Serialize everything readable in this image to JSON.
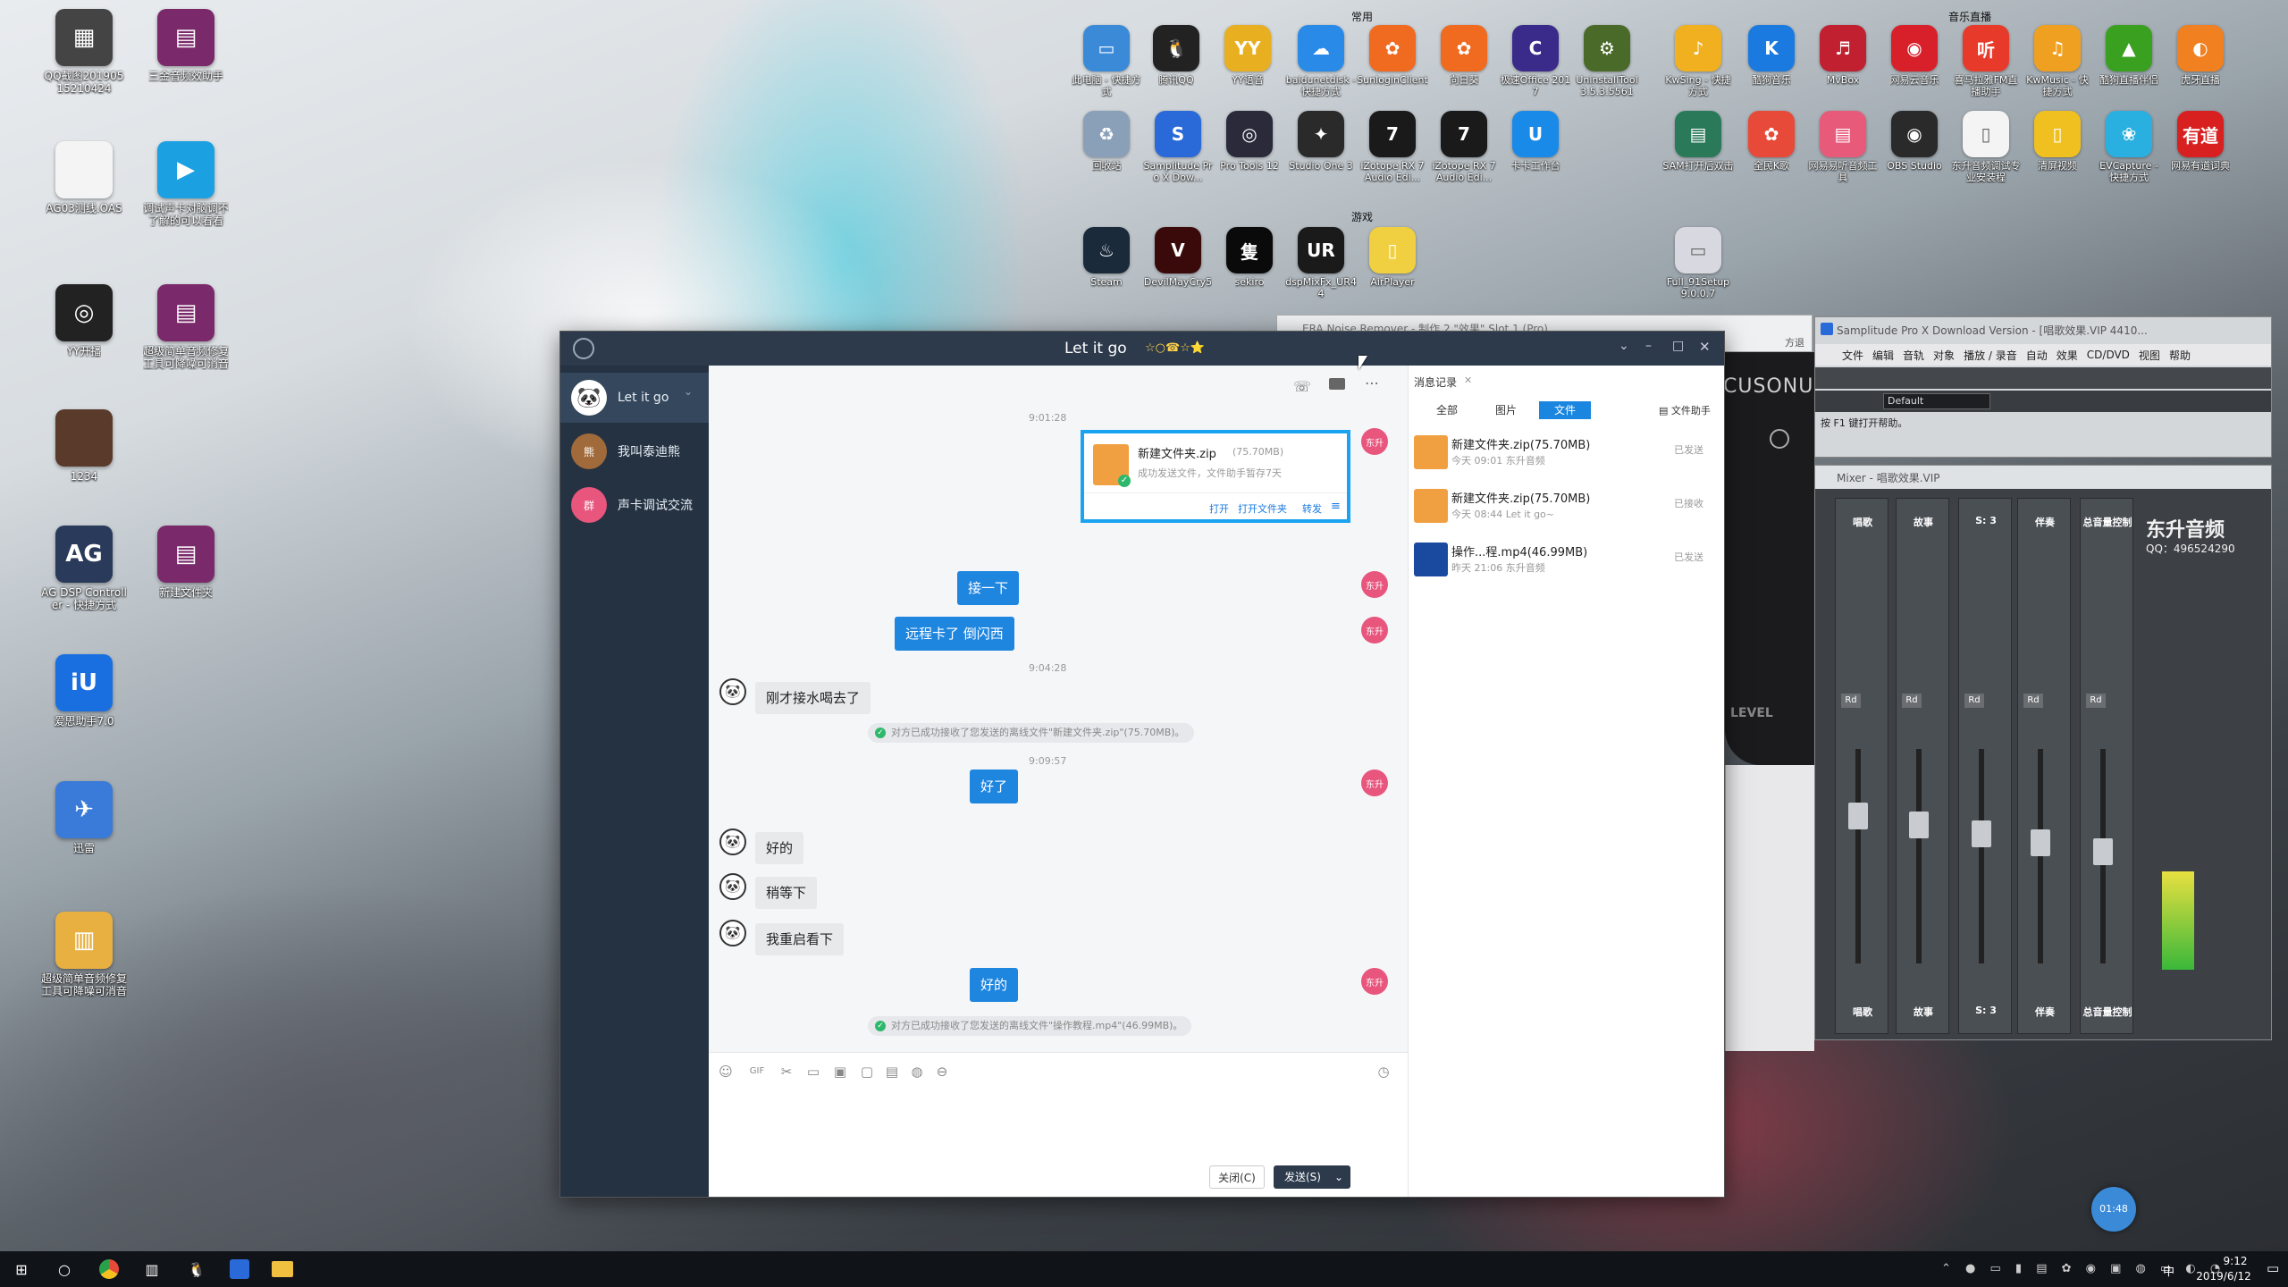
{
  "desktop": {
    "left_icons": [
      {
        "label": "QQ截图20190515210424",
        "color": "#444",
        "glyph": "▦"
      },
      {
        "label": "三金音频效助手",
        "color": "#7a2a6a",
        "glyph": "▤"
      },
      {
        "label": "AG03测线.OAS",
        "color": "#f4f4f4",
        "glyph": ""
      },
      {
        "label": "调试声卡对脑调不了解的可以看看",
        "color": "#1ba0e2",
        "glyph": "▶"
      },
      {
        "label": "YY开播",
        "color": "#222",
        "glyph": "◎"
      },
      {
        "label": "超级简单音频修复工具可降噪可消音",
        "color": "#7a2a6a",
        "glyph": "▤"
      },
      {
        "label": "1234",
        "color": "#5a3a2a",
        "glyph": ""
      },
      {
        "label": "AG DSP Controller - 快捷方式",
        "color": "#2a3a5a",
        "glyph": "AG"
      },
      {
        "label": "新建文件夹",
        "color": "#7a2a6a",
        "glyph": "▤"
      },
      {
        "label": "爱思助手7.0",
        "color": "#1a6fe0",
        "glyph": "iU"
      },
      {
        "label": "迅雷",
        "color": "#3a7ad8",
        "glyph": "✈"
      },
      {
        "label": "超级简单音频修复工具可降噪可消音",
        "color": "#e8b040",
        "glyph": "▥"
      }
    ],
    "top_headers": {
      "common": "常用",
      "music_live": "音乐直播",
      "games": "游戏"
    },
    "top_icons_row1": [
      {
        "label": "此电脑 - 快捷方式",
        "color": "#3a8ad8",
        "glyph": "▭"
      },
      {
        "label": "腾讯QQ",
        "color": "#222",
        "glyph": "🐧"
      },
      {
        "label": "YY语音",
        "color": "#e8b020",
        "glyph": "YY"
      },
      {
        "label": "baidunetdisk - 快捷方式",
        "color": "#2a8ae8",
        "glyph": "☁"
      },
      {
        "label": "SunloginClient",
        "color": "#f06a20",
        "glyph": "✿"
      },
      {
        "label": "向日葵",
        "color": "#f06a20",
        "glyph": "✿"
      },
      {
        "label": "极速Office 2017",
        "color": "#3a2a8a",
        "glyph": "C"
      },
      {
        "label": "UninstallTool 3.5.3.5561",
        "color": "#4a6a2a",
        "glyph": "⚙"
      },
      {
        "label": "KwSing - 快捷方式",
        "color": "#f0b020",
        "glyph": "♪"
      },
      {
        "label": "酷狗音乐",
        "color": "#1a7ae0",
        "glyph": "K"
      },
      {
        "label": "MvBox",
        "color": "#c02030",
        "glyph": "♬"
      },
      {
        "label": "网易云音乐",
        "color": "#d8202a",
        "glyph": "◉"
      },
      {
        "label": "喜马拉雅FM直播助手",
        "color": "#e83a2a",
        "glyph": "听"
      },
      {
        "label": "KwMusic - 快捷方式",
        "color": "#f0a020",
        "glyph": "♫"
      },
      {
        "label": "酷狗直播伴侣",
        "color": "#3aa020",
        "glyph": "▲"
      },
      {
        "label": "虎牙直播",
        "color": "#f08020",
        "glyph": "◐"
      }
    ],
    "top_icons_row2": [
      {
        "label": "回收站",
        "color": "#8aa0b8",
        "glyph": "♻"
      },
      {
        "label": "Samplitude Pro X Dow...",
        "color": "#2a6ad8",
        "glyph": "S"
      },
      {
        "label": "Pro Tools 12",
        "color": "#2a2a3a",
        "glyph": "◎"
      },
      {
        "label": "Studio One 3",
        "color": "#2a2a2a",
        "glyph": "✦"
      },
      {
        "label": "iZotope RX 7 Audio Edi...",
        "color": "#1a1a1a",
        "glyph": "7"
      },
      {
        "label": "iZotope RX 7 Audio Edi...",
        "color": "#1a1a1a",
        "glyph": "7"
      },
      {
        "label": "卡卡工作台",
        "color": "#1a8ae8",
        "glyph": "U"
      },
      {
        "label": "SAM打开后双击",
        "color": "#2a7a5a",
        "glyph": "▤"
      },
      {
        "label": "全民K歌",
        "color": "#e84a3a",
        "glyph": "✿"
      },
      {
        "label": "网易易听音频工具",
        "color": "#e85a7a",
        "glyph": "▤"
      },
      {
        "label": "OBS Studio",
        "color": "#2a2a2a",
        "glyph": "◉"
      },
      {
        "label": "东升音频调试专业安装程",
        "color": "#f4f4f4",
        "glyph": "▯"
      },
      {
        "label": "清屏视频",
        "color": "#f0c020",
        "glyph": "▯"
      },
      {
        "label": "EVCapture - 快捷方式",
        "color": "#2ab0e0",
        "glyph": "❀"
      },
      {
        "label": "网易有道词典",
        "color": "#d82020",
        "glyph": "有道"
      }
    ],
    "top_icons_row3": [
      {
        "label": "Steam",
        "color": "#1a2a3a",
        "glyph": "♨"
      },
      {
        "label": "DevilMayCry5",
        "color": "#3a0a0a",
        "glyph": "V"
      },
      {
        "label": "sekiro",
        "color": "#0a0a0a",
        "glyph": "隻"
      },
      {
        "label": "dspMixFx_UR44",
        "color": "#1a1a1a",
        "glyph": "UR"
      },
      {
        "label": "AirPlayer",
        "color": "#f0d040",
        "glyph": "▯"
      },
      {
        "label": "Full_91Setup 9.0.0.7",
        "color": "#d8d8e0",
        "glyph": "▭"
      }
    ]
  },
  "chat": {
    "title": "Let it go",
    "title_stars": "☆○☎☆⭐",
    "contacts": [
      {
        "name": "Let it go",
        "active": true,
        "avatar": "🐼",
        "avatar_color": "#fff"
      },
      {
        "name": "我叫泰迪熊",
        "active": false,
        "avatar": "熊",
        "avatar_color": "#a06a3a"
      },
      {
        "name": "声卡调试交流",
        "active": false,
        "avatar": "群",
        "avatar_color": "#e8557d"
      }
    ],
    "timestamps": [
      "9:01:28",
      "9:04:28",
      "9:09:57"
    ],
    "file_card": {
      "name": "新建文件夹.zip",
      "size": "(75.70MB)",
      "status": "成功发送文件，文件助手暂存7天",
      "actions": [
        "打开",
        "打开文件夹",
        "转发"
      ]
    },
    "outgoing": [
      "接一下",
      "远程卡了 倒闪西",
      "好了",
      "好的"
    ],
    "incoming": [
      "刚才接水喝去了",
      "好的",
      "稍等下",
      "我重启看下"
    ],
    "system_messages": [
      "对方已成功接收了您发送的离线文件\"新建文件夹.zip\"(75.70MB)。",
      "对方已成功接收了您发送的离线文件\"操作教程.mp4\"(46.99MB)。"
    ],
    "my_avatar_text": "东升",
    "buttons": {
      "close": "关闭(C)",
      "send": "发送(S)"
    },
    "right_panel": {
      "title": "消息记录",
      "tabs": [
        "全部",
        "图片",
        "文件"
      ],
      "active_tab": "文件",
      "assistant": "文件助手",
      "records": [
        {
          "name": "新建文件夹.zip(75.70MB)",
          "time": "今天 09:01 东升音频",
          "status": "已发送",
          "color": "#f0a040"
        },
        {
          "name": "新建文件夹.zip(75.70MB)",
          "time": "今天 08:44 Let it go~",
          "status": "已接收",
          "color": "#f0a040"
        },
        {
          "name": "操作...程.mp4(46.99MB)",
          "time": "昨天 21:06 东升音频",
          "status": "已发送",
          "color": "#1a4aa0"
        }
      ]
    }
  },
  "background_window": {
    "title": "ERA Noise Remover - 制作 2 \"效果\" Slot 1 (Pro)",
    "right_text": "方退"
  },
  "daw": {
    "main_title": "Samplitude Pro X Download Version - [唱歌效果.VIP   4410...",
    "menu": [
      "文件",
      "编辑",
      "音轨",
      "对象",
      "播放 / 录音",
      "自动",
      "效果",
      "CD/DVD",
      "视图",
      "帮助"
    ],
    "preset": "Default",
    "help_text": "按 F1 键打开帮助。",
    "mixer_title": "Mixer - 唱歌效果.VIP",
    "brand": "东升音频",
    "qq": "QQ：496524290",
    "channels": [
      "唱歌",
      "故事",
      "S: 3",
      "伴奏",
      "总音量控制"
    ],
    "level_label": "LEVEL",
    "bg_brand": "CUSONUS"
  },
  "badge": "01:48",
  "taskbar": {
    "time": "9:12",
    "date": "2019/6/12",
    "lang": "中"
  }
}
